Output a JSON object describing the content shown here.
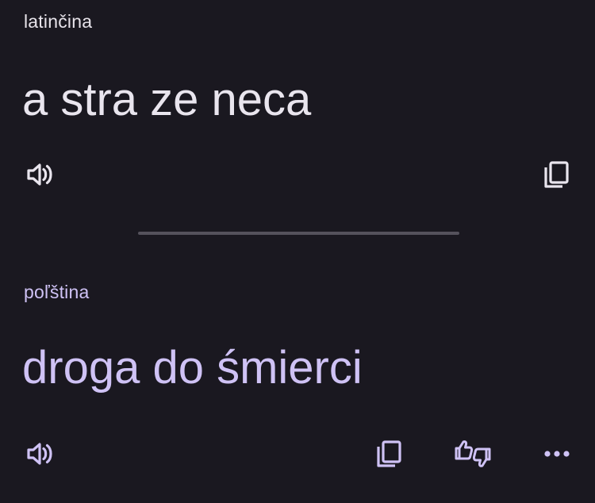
{
  "source": {
    "language": "latinčina",
    "text": "a stra ze neca",
    "icons": {
      "listen": "volume-icon",
      "copy": "copy-icon"
    }
  },
  "target": {
    "language": "poľština",
    "text": "droga do śmierci",
    "icons": {
      "listen": "volume-icon",
      "copy": "copy-icon",
      "rate": "thumbs-feedback-icon",
      "more": "more-icon"
    }
  },
  "colors": {
    "background": "#1a1820",
    "source_text": "#e9e5ee",
    "accent": "#cfc2f5",
    "divider": "#55525c"
  }
}
